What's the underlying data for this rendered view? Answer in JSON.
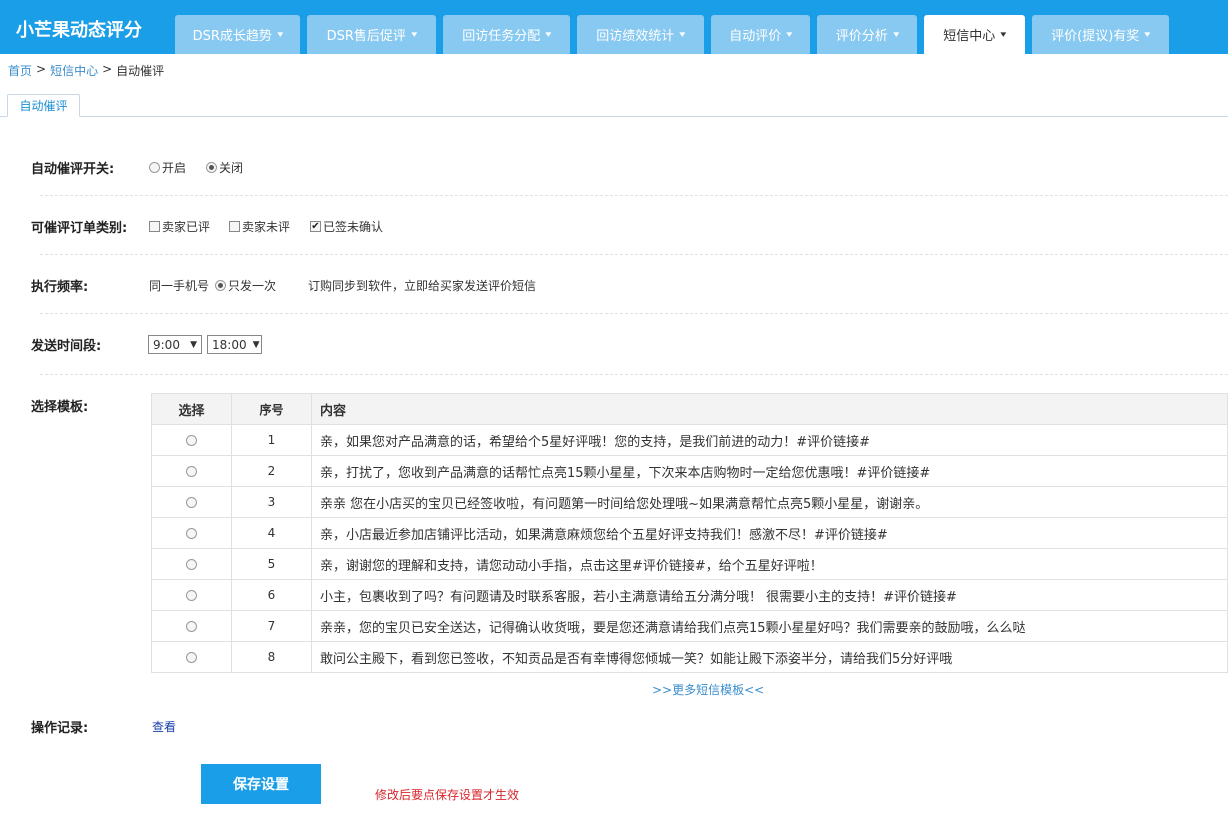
{
  "app": {
    "title": "小芒果动态评分"
  },
  "nav": {
    "tabs": [
      {
        "label": "DSR成长趋势"
      },
      {
        "label": "DSR售后促评"
      },
      {
        "label": "回访任务分配"
      },
      {
        "label": "回访绩效统计"
      },
      {
        "label": "自动评价"
      },
      {
        "label": "评价分析"
      },
      {
        "label": "短信中心",
        "active": true
      },
      {
        "label": "评价(提议)有奖"
      }
    ],
    "chevron": "▾"
  },
  "breadcrumb": {
    "home": "首页",
    "sep": ">",
    "section": "短信中心",
    "current": "自动催评"
  },
  "subtab": {
    "label": "自动催评"
  },
  "form": {
    "switch": {
      "label": "自动催评开关:",
      "options": [
        "开启",
        "关闭"
      ],
      "selected": "关闭"
    },
    "order_types": {
      "label": "可催评订单类别:",
      "options": [
        {
          "label": "卖家已评",
          "checked": false
        },
        {
          "label": "卖家未评",
          "checked": false
        },
        {
          "label": "已签未确认",
          "checked": true
        }
      ]
    },
    "frequency": {
      "label": "执行频率:",
      "prefix": "同一手机号",
      "option": "只发一次",
      "note": "订购同步到软件，立即给买家发送评价短信"
    },
    "time_range": {
      "label": "发送时间段:",
      "start": "9:00",
      "end": "18:00"
    },
    "template": {
      "label": "选择模板:",
      "headers": [
        "选择",
        "序号",
        "内容"
      ],
      "rows": [
        {
          "no": "1",
          "content": "亲，如果您对产品满意的话，希望给个5星好评哦！您的支持，是我们前进的动力！#评价链接#"
        },
        {
          "no": "2",
          "content": "亲，打扰了，您收到产品满意的话帮忙点亮15颗小星星，下次来本店购物时一定给您优惠哦！#评价链接#"
        },
        {
          "no": "3",
          "content": "亲亲 您在小店买的宝贝已经签收啦，有问题第一时间给您处理哦~如果满意帮忙点亮5颗小星星，谢谢亲。"
        },
        {
          "no": "4",
          "content": "亲，小店最近参加店铺评比活动，如果满意麻烦您给个五星好评支持我们！感激不尽！#评价链接#"
        },
        {
          "no": "5",
          "content": "亲，谢谢您的理解和支持，请您动动小手指，点击这里#评价链接#，给个五星好评啦！"
        },
        {
          "no": "6",
          "content": "小主，包裹收到了吗？有问题请及时联系客服，若小主满意请给五分满分哦！  很需要小主的支持！#评价链接#"
        },
        {
          "no": "7",
          "content": "亲亲，您的宝贝已安全送达，记得确认收货哦，要是您还满意请给我们点亮15颗小星星好吗？我们需要亲的鼓励哦，么么哒"
        },
        {
          "no": "8",
          "content": "敢问公主殿下，看到您已签收，不知贡品是否有幸博得您倾城一笑？如能让殿下添姿半分，请给我们5分好评哦"
        }
      ],
      "more_link": ">>更多短信模板<<"
    },
    "log": {
      "label": "操作记录:",
      "link": "查看"
    }
  },
  "actions": {
    "save_label": "保存设置",
    "note": "修改后要点保存设置才生效"
  },
  "colors": {
    "brand": "#1a9ee7",
    "nav_inactive": "#88c9f1",
    "warn": "#d9252a"
  }
}
